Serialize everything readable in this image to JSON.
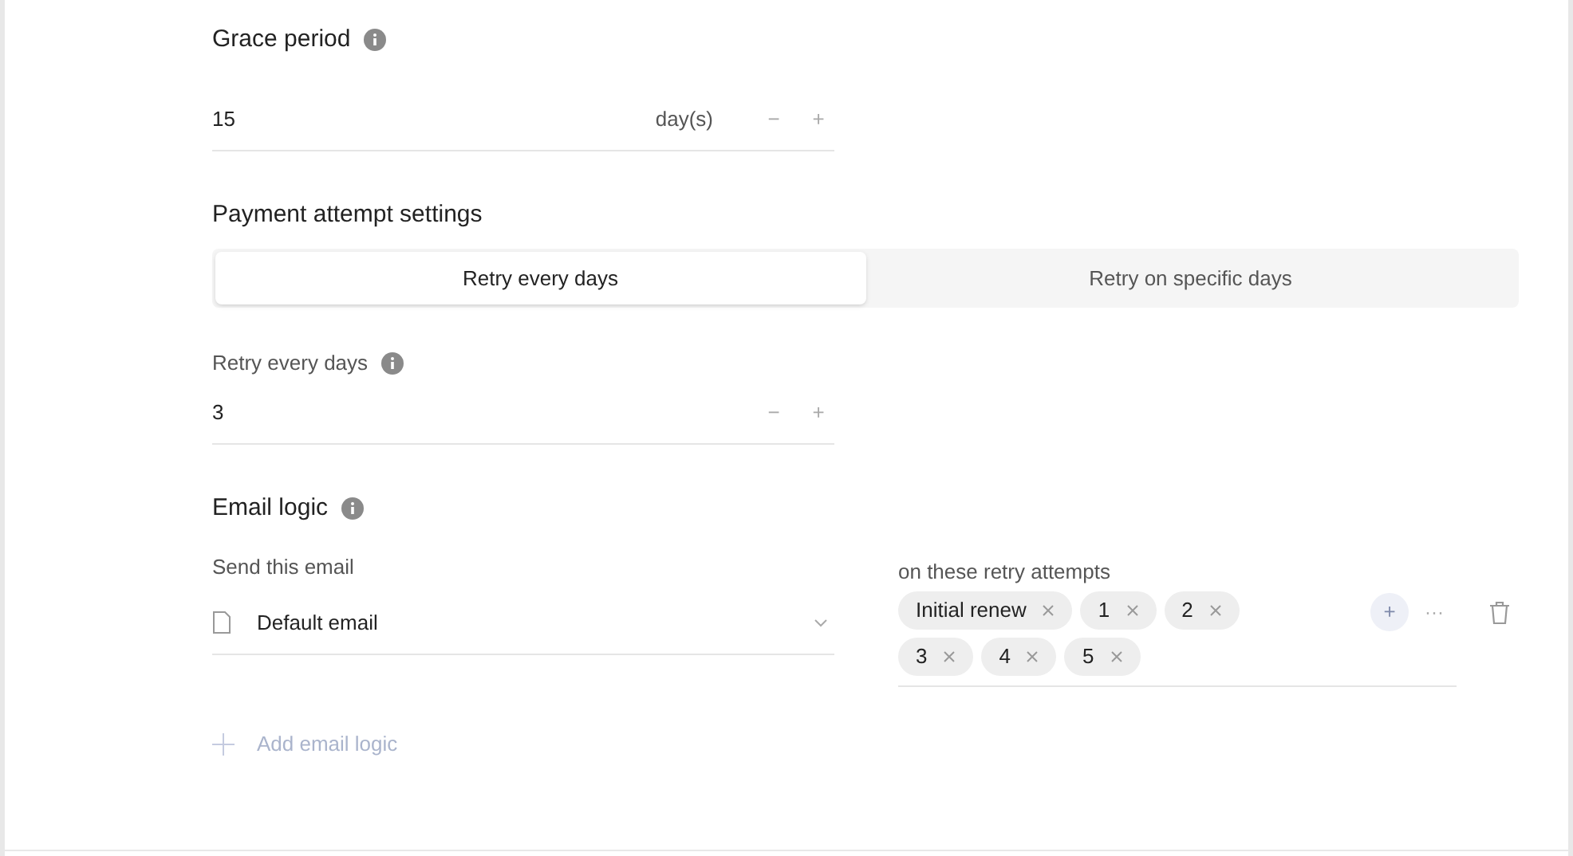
{
  "grace_period": {
    "title": "Grace period",
    "value": "15",
    "unit": "day(s)",
    "decrement": "−",
    "increment": "+"
  },
  "payment_attempt_settings": {
    "title": "Payment attempt settings",
    "tabs": [
      {
        "label": "Retry every days",
        "selected": true
      },
      {
        "label": "Retry on specific days",
        "selected": false
      }
    ],
    "retry_every_days": {
      "label": "Retry every days",
      "value": "3",
      "decrement": "−",
      "increment": "+"
    }
  },
  "email_logic": {
    "title": "Email logic",
    "send_label": "Send this email",
    "email": "Default email",
    "attempts_label": "on these retry attempts",
    "attempts": [
      {
        "label": "Initial renew"
      },
      {
        "label": "1"
      },
      {
        "label": "2"
      },
      {
        "label": "3"
      },
      {
        "label": "4"
      },
      {
        "label": "5"
      }
    ],
    "add_attempt": "+",
    "more": "···",
    "add_logic": "Add email logic"
  }
}
